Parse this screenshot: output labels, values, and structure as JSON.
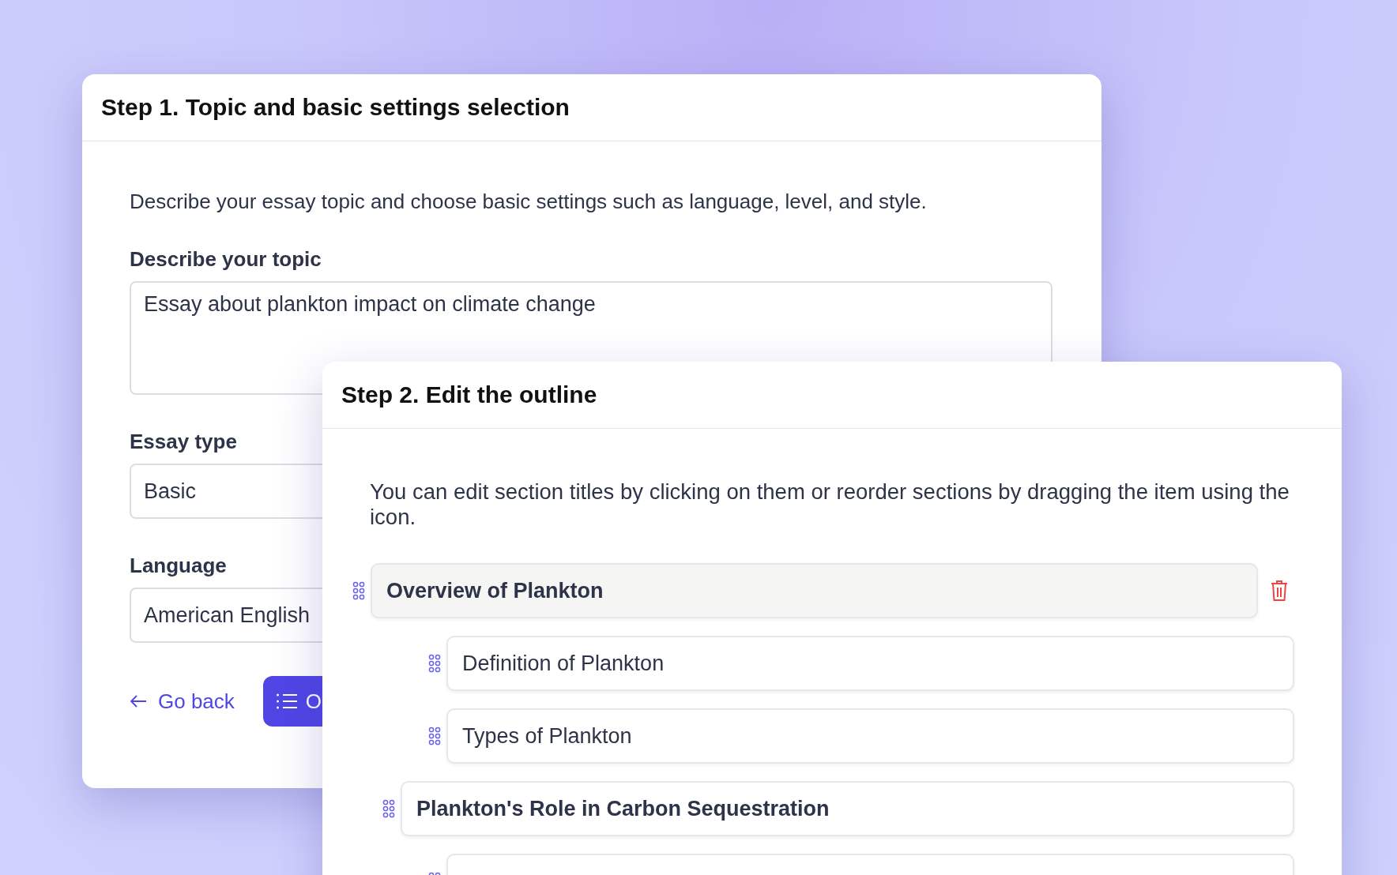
{
  "step1": {
    "title": "Step 1. Topic and basic settings selection",
    "description": "Describe your essay topic and choose basic settings such as language, level, and style.",
    "fields": [
      {
        "kind": "textarea",
        "label": "Describe your topic",
        "value": "Essay about plankton impact on climate change"
      },
      {
        "kind": "select",
        "label": "Essay type",
        "value": "Basic"
      },
      {
        "kind": "select",
        "label": "Language",
        "value": "American English"
      }
    ],
    "back_link": "Go back",
    "primary_button": "O"
  },
  "step2": {
    "title": "Step 2. Edit the outline",
    "description": "You can edit section titles by clicking on them or reorder sections by dragging the item using the icon.",
    "outline": [
      {
        "title": "Overview of Plankton",
        "hovered": true,
        "children": [
          {
            "title": "Definition of Plankton",
            "hovered": false
          },
          {
            "title": "Types of Plankton",
            "hovered": false
          }
        ]
      },
      {
        "title": "Plankton's Role in Carbon Sequestration",
        "hovered": false,
        "children": [
          {
            "hovered": false
          }
        ]
      }
    ]
  }
}
